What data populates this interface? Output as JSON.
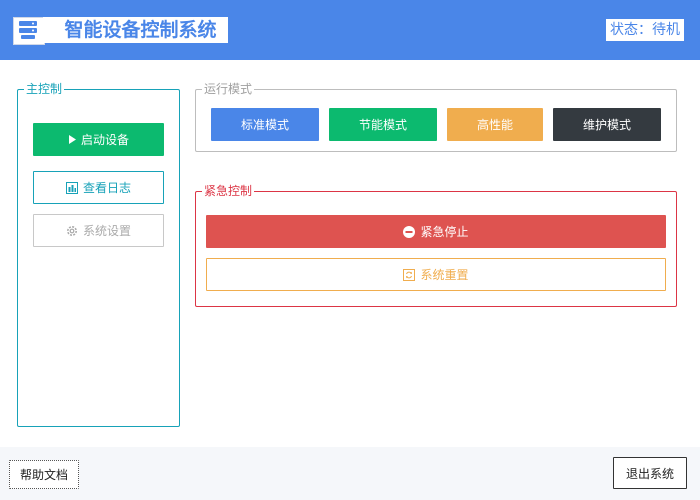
{
  "header": {
    "title": "智能设备控制系统",
    "status": "状态：待机",
    "icon": "server-icon"
  },
  "main_control": {
    "legend": "主控制",
    "start_label": "启动设备",
    "log_label": "查看日志",
    "settings_label": "系统设置"
  },
  "modes": {
    "legend": "运行模式",
    "items": [
      "标准模式",
      "节能模式",
      "高性能",
      "维护模式"
    ]
  },
  "emergency": {
    "legend": "紧急控制",
    "stop_label": "紧急停止",
    "reset_label": "系统重置"
  },
  "footer": {
    "help_label": "帮助文档",
    "exit_label": "退出系统"
  },
  "colors": {
    "primary": "#4a86e8",
    "success": "#0cba6f",
    "info": "#17a2b8",
    "warning": "#f0ad4e",
    "danger": "#de5350",
    "dark": "#343a40"
  }
}
